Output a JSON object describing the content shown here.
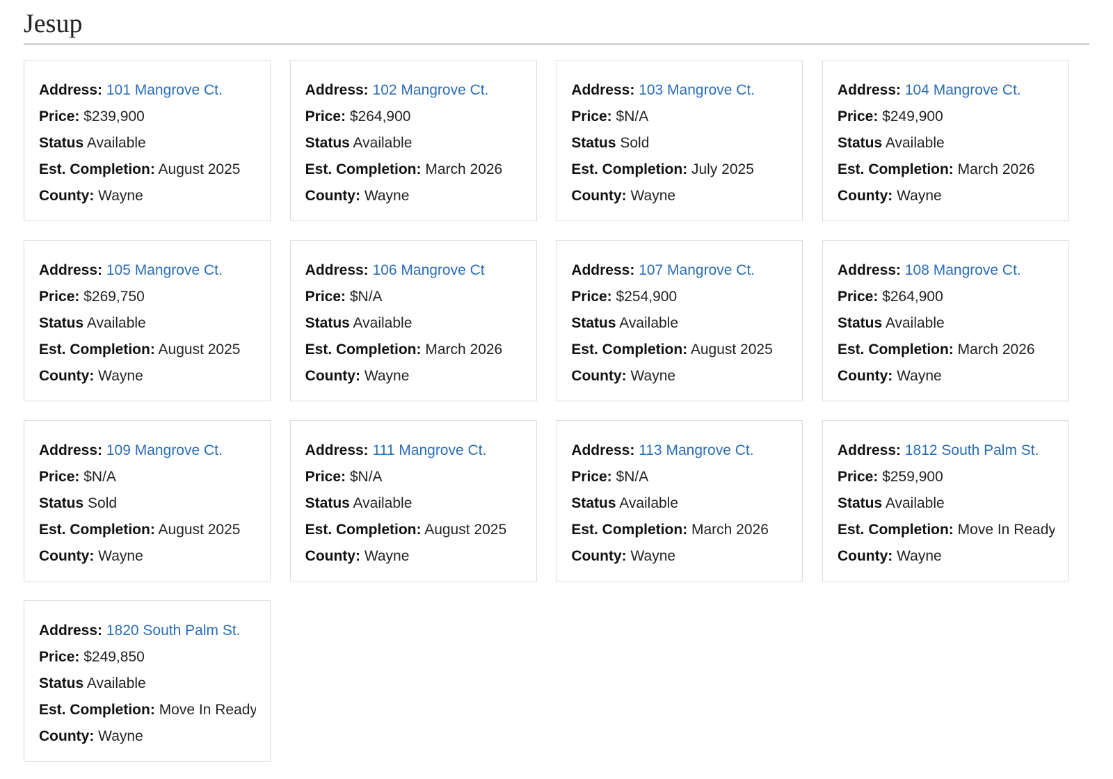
{
  "page": {
    "title": "Jesup"
  },
  "labels": {
    "address": "Address:",
    "price": "Price:",
    "status": "Status",
    "completion": "Est. Completion:",
    "county": "County:"
  },
  "colors": {
    "link": "#2a6db5",
    "border": "#dcdcdc",
    "rule": "#d4d4d4"
  },
  "listings": [
    {
      "address": "101 Mangrove Ct.",
      "price": "$239,900",
      "status": "Available",
      "completion": "August 2025",
      "county": "Wayne"
    },
    {
      "address": "102 Mangrove Ct.",
      "price": "$264,900",
      "status": "Available",
      "completion": "March 2026",
      "county": "Wayne"
    },
    {
      "address": "103 Mangrove Ct.",
      "price": "$N/A",
      "status": "Sold",
      "completion": "July 2025",
      "county": "Wayne"
    },
    {
      "address": "104 Mangrove Ct.",
      "price": "$249,900",
      "status": "Available",
      "completion": "March 2026",
      "county": "Wayne"
    },
    {
      "address": "105 Mangrove Ct.",
      "price": "$269,750",
      "status": "Available",
      "completion": "August 2025",
      "county": "Wayne"
    },
    {
      "address": "106 Mangrove Ct",
      "price": "$N/A",
      "status": "Available",
      "completion": "March 2026",
      "county": "Wayne"
    },
    {
      "address": "107 Mangrove Ct.",
      "price": "$254,900",
      "status": "Available",
      "completion": "August 2025",
      "county": "Wayne"
    },
    {
      "address": "108 Mangrove Ct.",
      "price": "$264,900",
      "status": "Available",
      "completion": "March 2026",
      "county": "Wayne"
    },
    {
      "address": "109 Mangrove Ct.",
      "price": "$N/A",
      "status": "Sold",
      "completion": "August 2025",
      "county": "Wayne"
    },
    {
      "address": "111 Mangrove Ct.",
      "price": "$N/A",
      "status": "Available",
      "completion": "August 2025",
      "county": "Wayne"
    },
    {
      "address": "113 Mangrove Ct.",
      "price": "$N/A",
      "status": "Available",
      "completion": "March 2026",
      "county": "Wayne"
    },
    {
      "address": "1812 South Palm St.",
      "price": "$259,900",
      "status": "Available",
      "completion": "Move In Ready",
      "county": "Wayne"
    },
    {
      "address": "1820 South Palm St.",
      "price": "$249,850",
      "status": "Available",
      "completion": "Move In Ready",
      "county": "Wayne"
    }
  ]
}
